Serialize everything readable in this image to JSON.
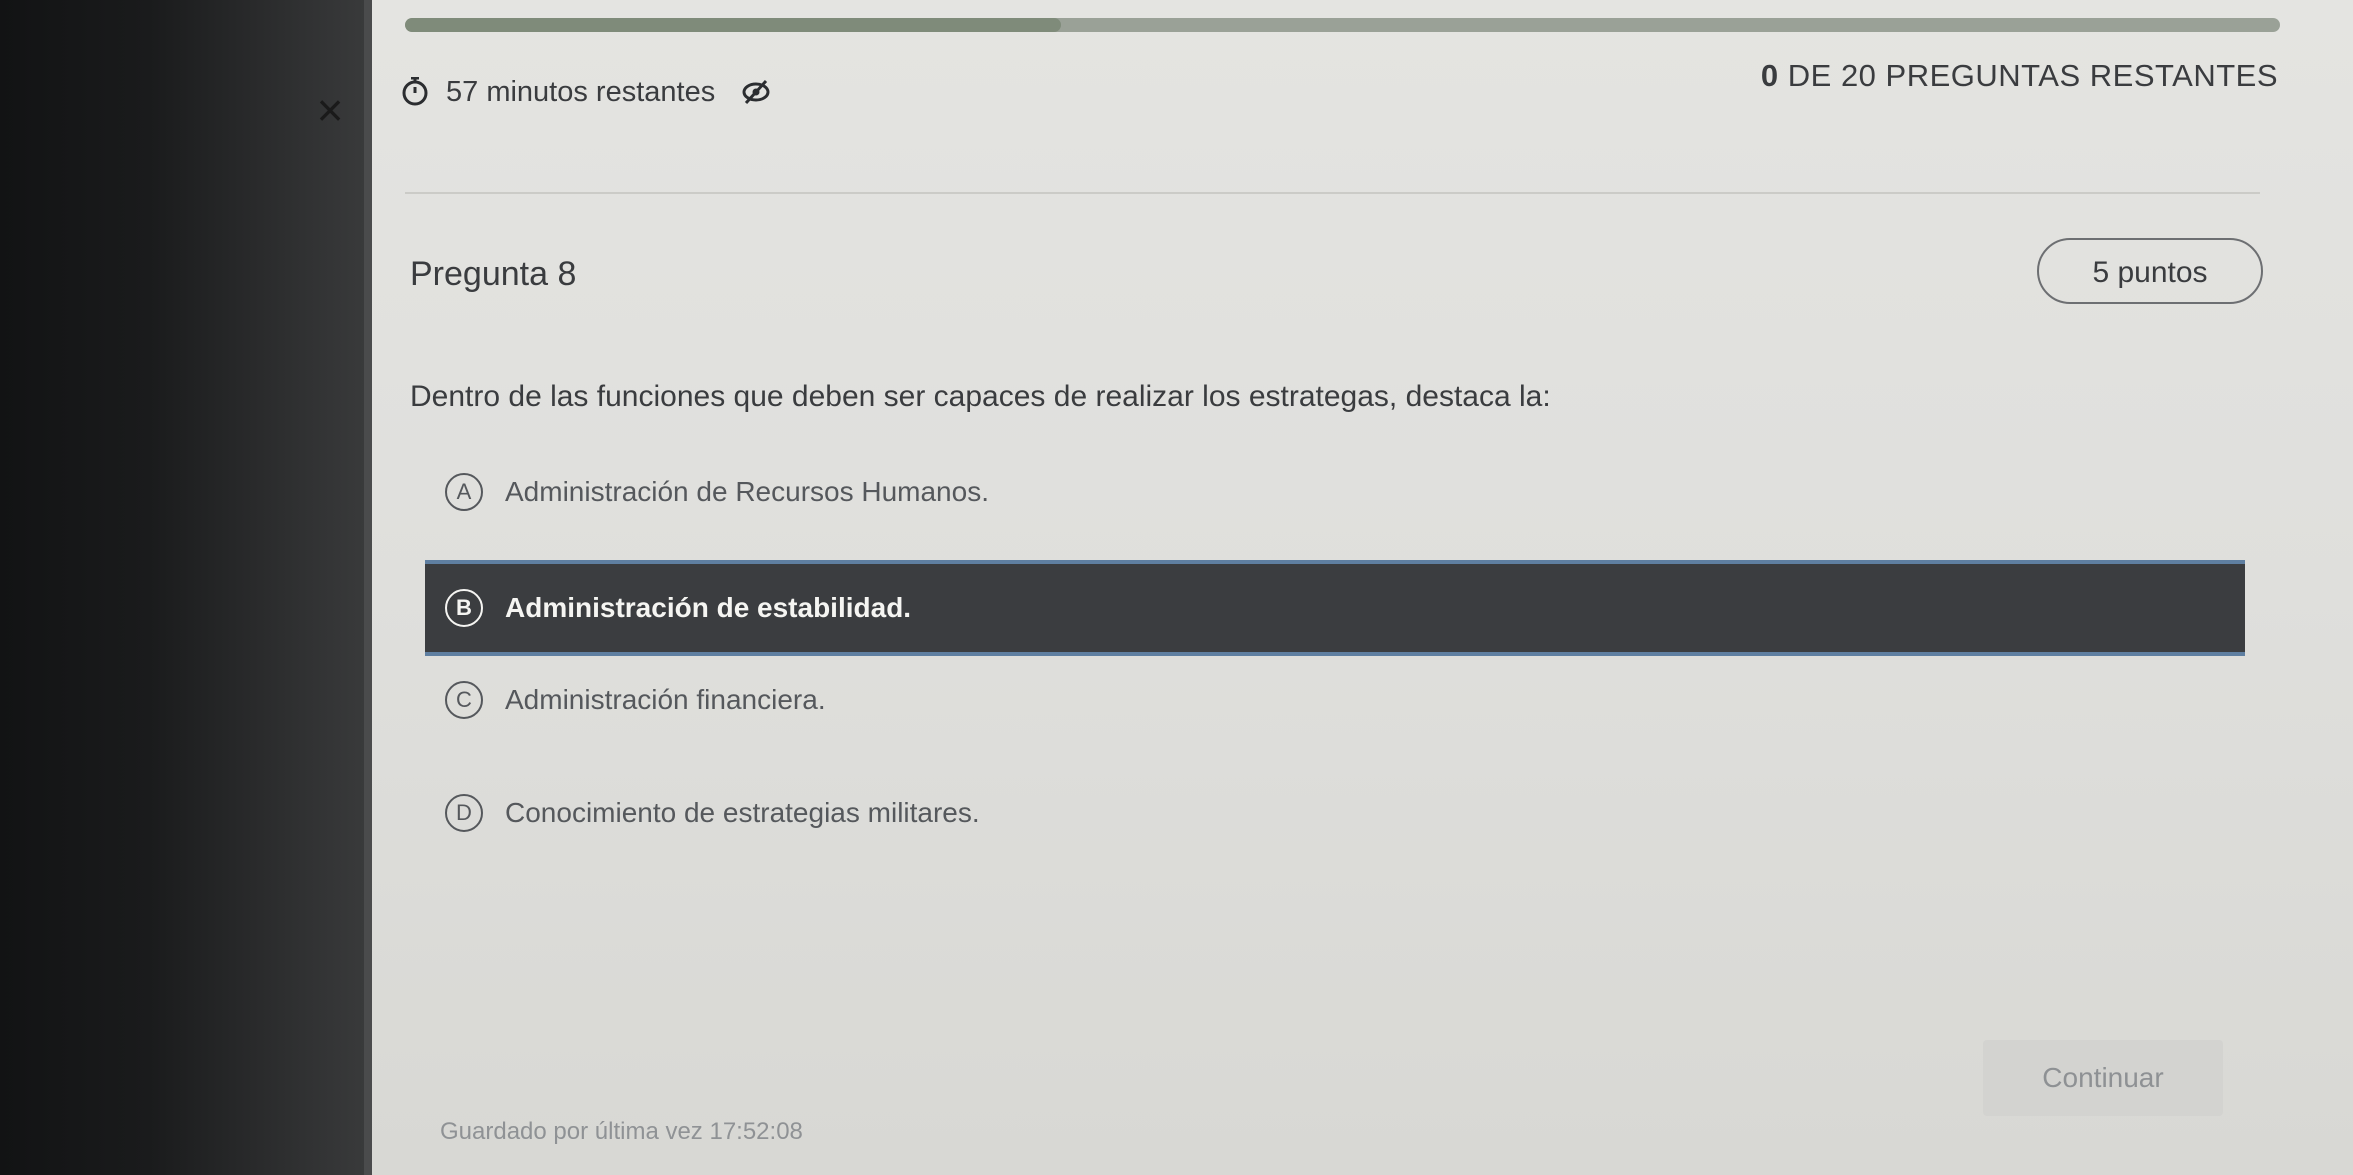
{
  "header": {
    "close_symbol": "×",
    "timer_icon": "timer-icon",
    "timer_text": "57 minutos restantes",
    "hide_icon": "eye-slash-icon",
    "remaining_count": "0",
    "remaining_text": " DE 20 PREGUNTAS RESTANTES",
    "progress_fraction": 0.35
  },
  "question": {
    "title": "Pregunta 8",
    "points": "5 puntos",
    "text": "Dentro de las funciones que deben ser capaces de realizar los estrategas, destaca la:"
  },
  "options": [
    {
      "letter": "A",
      "label": "Administración de Recursos Humanos.",
      "selected": false
    },
    {
      "letter": "B",
      "label": "Administración de estabilidad.",
      "selected": true
    },
    {
      "letter": "C",
      "label": "Administración financiera.",
      "selected": false
    },
    {
      "letter": "D",
      "label": "Conocimiento de estrategias militares.",
      "selected": false
    }
  ],
  "footer": {
    "continue_label": "Continuar",
    "saved_text": "Guardado por última vez 17:52:08"
  },
  "colors": {
    "selected_bg": "#3b3d40",
    "selected_border": "#5f7fa1",
    "progress_fill": "#7f8b7a"
  }
}
